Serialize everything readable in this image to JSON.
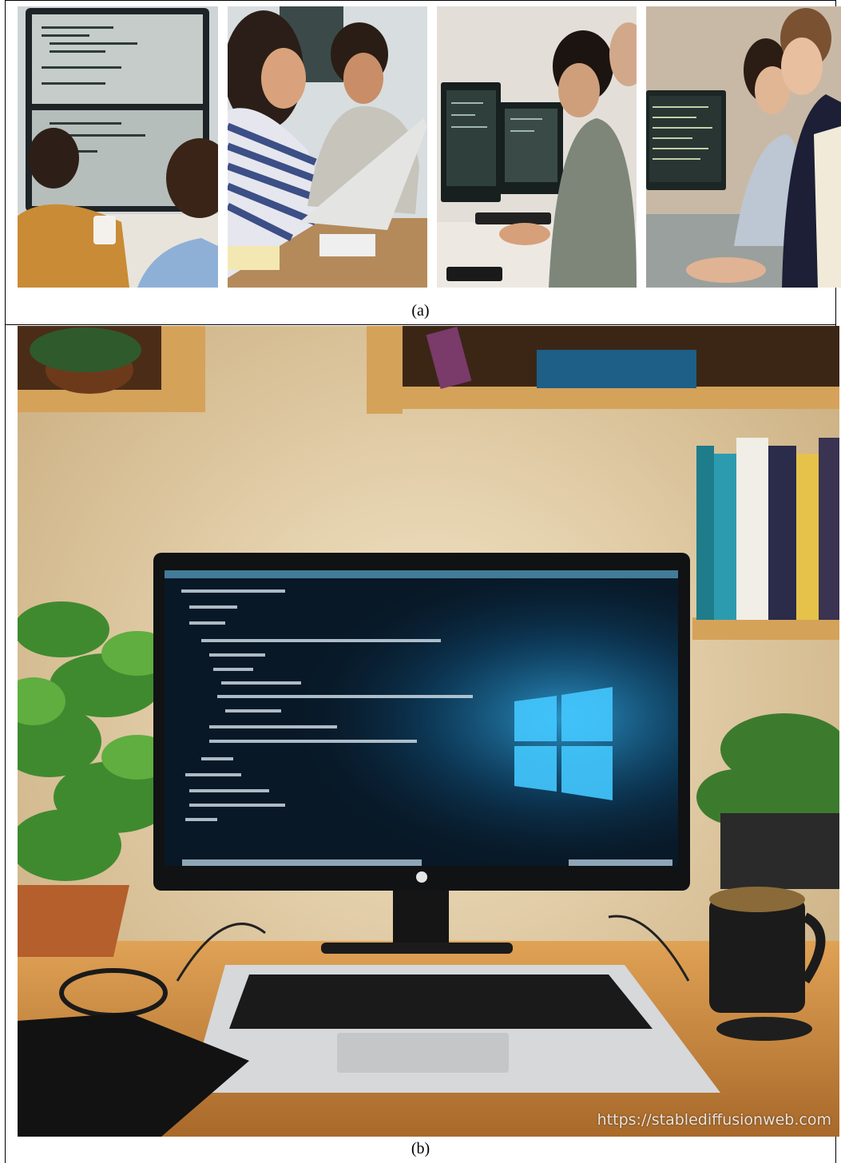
{
  "figure": {
    "part_a": {
      "caption": "(a)",
      "photos": [
        {
          "name": "photo-two-students-monitor"
        },
        {
          "name": "photo-students-laptop"
        },
        {
          "name": "photo-student-dual-monitors"
        },
        {
          "name": "photo-students-terminal"
        }
      ]
    },
    "part_b": {
      "caption": "(b)",
      "watermark": "https://stablediffusionweb.com"
    }
  },
  "colors": {
    "screen_bg": "#0a1c2c",
    "windows_blue": "#3ec7ff",
    "wall": "#e9d7b5",
    "desk": "#c98a3c"
  }
}
